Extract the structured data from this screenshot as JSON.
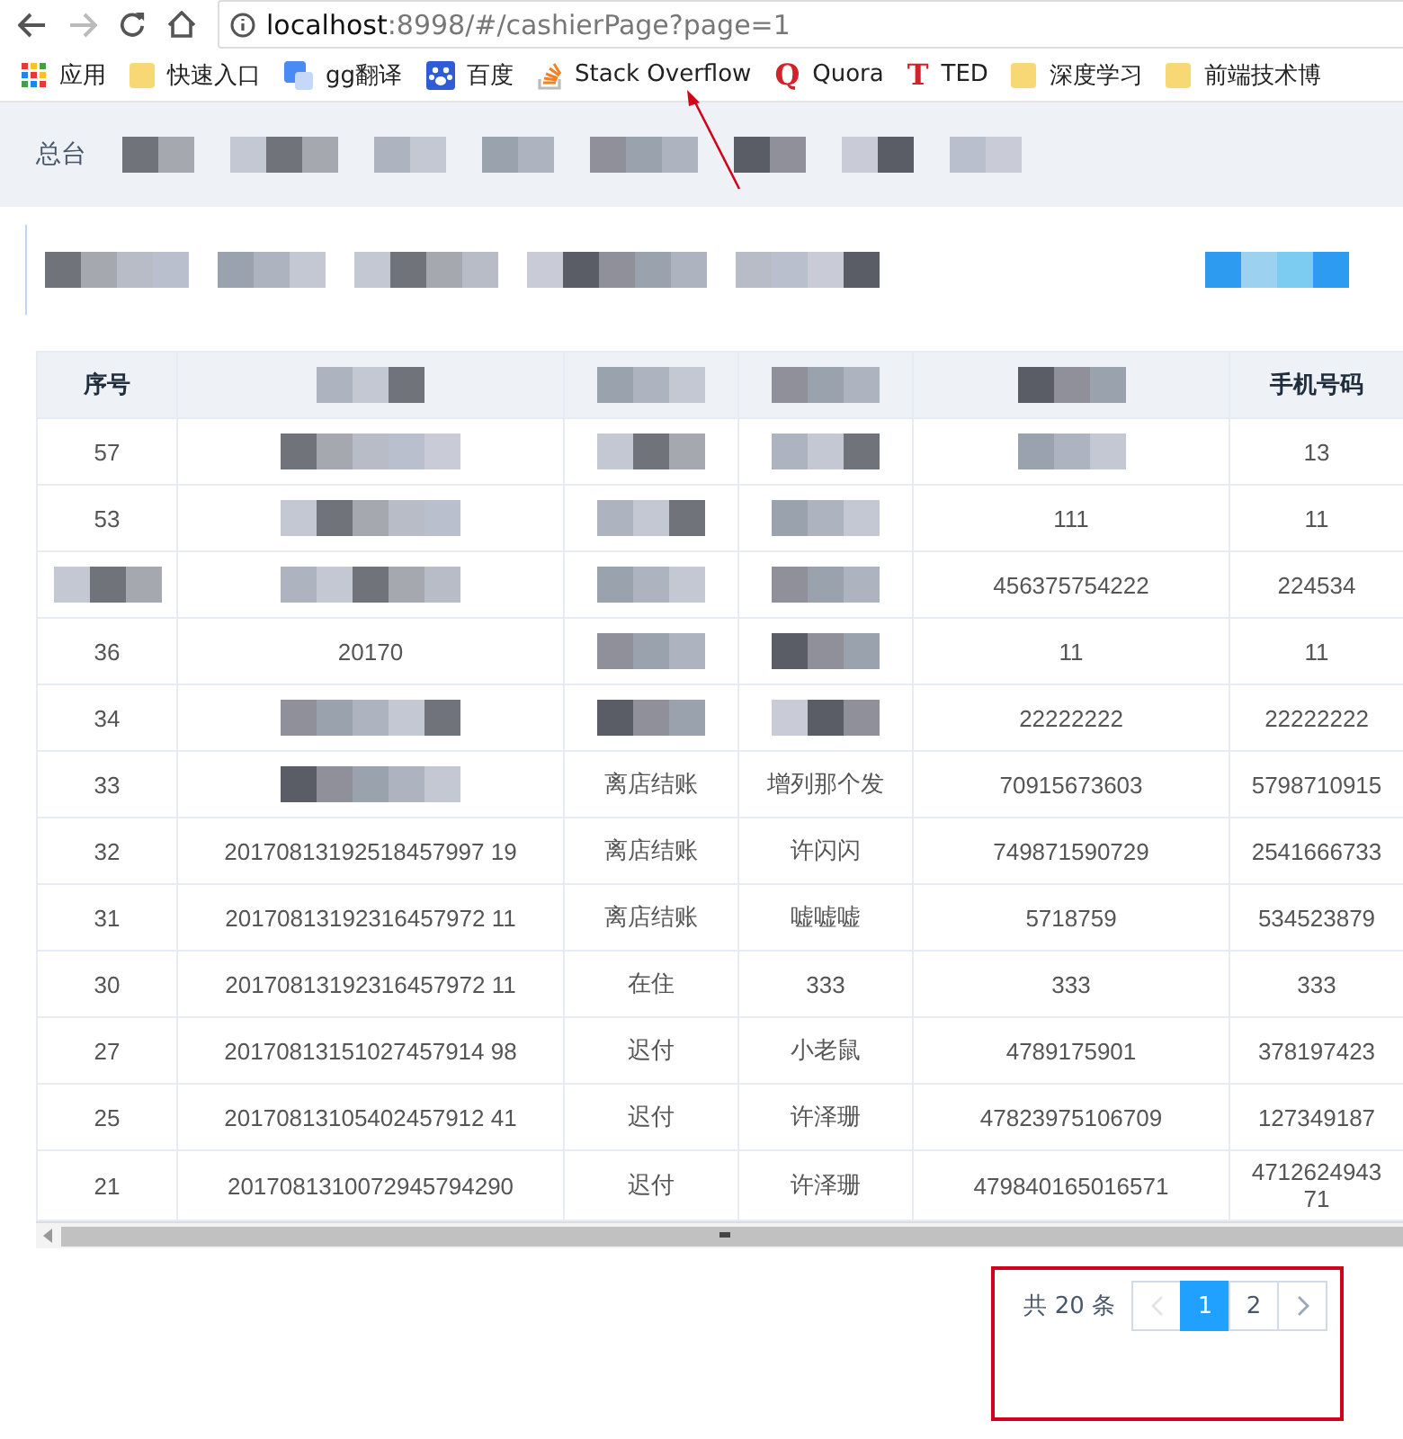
{
  "browser": {
    "url_host": "localhost",
    "url_path": ":8998/#/cashierPage?page=1"
  },
  "bookmarks": [
    {
      "kind": "apps",
      "label": "应用"
    },
    {
      "kind": "folder",
      "label": "快速入口"
    },
    {
      "kind": "translate",
      "label": "gg翻译"
    },
    {
      "kind": "paw",
      "label": "百度"
    },
    {
      "kind": "stack",
      "label": "Stack Overflow"
    },
    {
      "kind": "letter",
      "glyph": "Q",
      "label": "Quora"
    },
    {
      "kind": "letter",
      "glyph": "T",
      "label": "TED"
    },
    {
      "kind": "folder",
      "label": "深度学习"
    },
    {
      "kind": "folder",
      "label": "前端技术博"
    }
  ],
  "nav": {
    "items": [
      "总台"
    ]
  },
  "table": {
    "columns": [
      "序号",
      null,
      null,
      null,
      null,
      "手机号码"
    ],
    "rows": [
      [
        "57",
        null,
        null,
        null,
        null,
        "13"
      ],
      [
        "53",
        null,
        null,
        null,
        "111",
        "11"
      ],
      [
        null,
        null,
        null,
        null,
        "456375754222",
        "224534"
      ],
      [
        "36",
        "20170",
        null,
        null,
        "11",
        "11"
      ],
      [
        "34",
        null,
        null,
        null,
        "22222222",
        "22222222"
      ],
      [
        "33",
        null,
        "离店结账",
        "增列那个发",
        "70915673603",
        "5798710915"
      ],
      [
        "32",
        "20170813192518457997 19",
        "离店结账",
        "许闪闪",
        "749871590729",
        "2541666733"
      ],
      [
        "31",
        "20170813192316457972 11",
        "离店结账",
        "嘘嘘嘘",
        "5718759",
        "534523879"
      ],
      [
        "30",
        "20170813192316457972 11",
        "在住",
        "333",
        "333",
        "333"
      ],
      [
        "27",
        "20170813151027457914 98",
        "迟付",
        "小老鼠",
        "4789175901",
        "378197423"
      ],
      [
        "25",
        "20170813105402457912 41",
        "迟付",
        "许泽珊",
        "47823975106709",
        "127349187"
      ],
      [
        "21",
        "2017081310072945794290",
        "迟付",
        "许泽珊",
        "479840165016571",
        "471262494371"
      ]
    ]
  },
  "pagination": {
    "total": "共 20 条",
    "prev_disabled": true,
    "next_disabled": false,
    "pages": [
      {
        "label": "1",
        "selected": true
      },
      {
        "label": "2",
        "selected": false
      }
    ]
  }
}
